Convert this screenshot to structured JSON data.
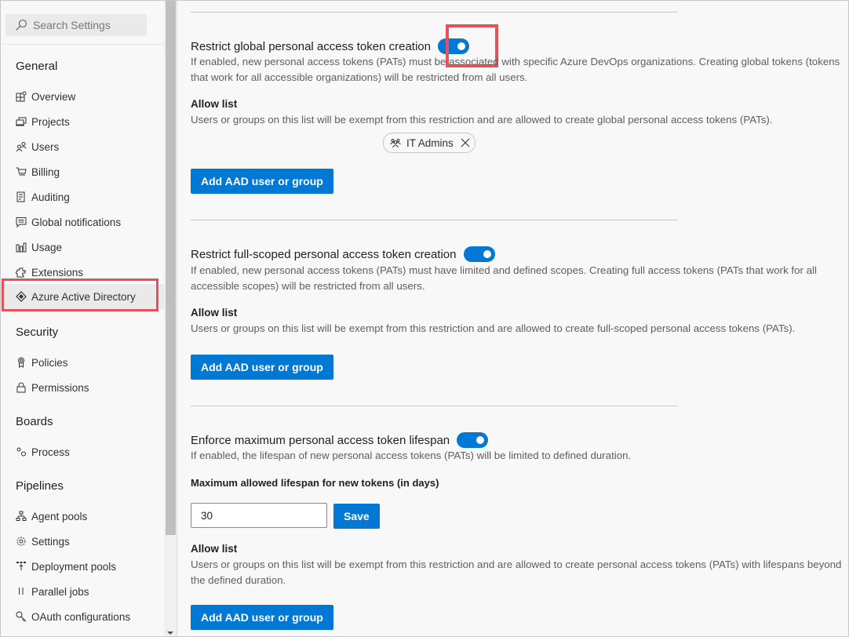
{
  "search": {
    "placeholder": "Search Settings",
    "icon": "search-icon"
  },
  "sidebar": {
    "groups": [
      {
        "title": "General"
      },
      {
        "title": "Security"
      },
      {
        "title": "Boards"
      },
      {
        "title": "Pipelines"
      }
    ],
    "items": [
      {
        "label": "Overview",
        "icon": "overview-icon"
      },
      {
        "label": "Projects",
        "icon": "projects-icon"
      },
      {
        "label": "Users",
        "icon": "users-icon"
      },
      {
        "label": "Billing",
        "icon": "cart-icon"
      },
      {
        "label": "Auditing",
        "icon": "auditing-icon"
      },
      {
        "label": "Global notifications",
        "icon": "notification-icon"
      },
      {
        "label": "Usage",
        "icon": "usage-icon"
      },
      {
        "label": "Extensions",
        "icon": "extensions-icon"
      },
      {
        "label": "Azure Active Directory",
        "icon": "aad-icon",
        "selected": true
      },
      {
        "label": "Policies",
        "icon": "policy-icon"
      },
      {
        "label": "Permissions",
        "icon": "lock-icon"
      },
      {
        "label": "Process",
        "icon": "process-icon"
      },
      {
        "label": "Agent pools",
        "icon": "agent-pools-icon"
      },
      {
        "label": "Settings",
        "icon": "gear-icon"
      },
      {
        "label": "Deployment pools",
        "icon": "deployment-pools-icon"
      },
      {
        "label": "Parallel jobs",
        "icon": "parallel-jobs-icon"
      },
      {
        "label": "OAuth configurations",
        "icon": "key-icon"
      }
    ]
  },
  "sections": [
    {
      "title": "Restrict global personal access token creation",
      "enabled": true,
      "description": "If enabled, new personal access tokens (PATs) must be associated with specific Azure DevOps organizations. Creating global tokens (tokens that work for all accessible organizations) will be restricted from all users.",
      "allow_list_label": "Allow list",
      "allow_list_description": "Users or groups on this list will be exempt from this restriction and are allowed to create global personal access tokens (PATs).",
      "allow_list_entries": [
        {
          "name": "IT Admins",
          "icon": "group-icon"
        }
      ],
      "add_button": "Add AAD user or group"
    },
    {
      "title": "Restrict full-scoped personal access token creation",
      "enabled": true,
      "description": "If enabled, new personal access tokens (PATs) must have limited and defined scopes. Creating full access tokens (PATs that work for all accessible scopes) will be restricted from all users.",
      "allow_list_label": "Allow list",
      "allow_list_description": "Users or groups on this list will be exempt from this restriction and are allowed to create full-scoped personal access tokens (PATs).",
      "add_button": "Add AAD user or group"
    },
    {
      "title": "Enforce maximum personal access token lifespan",
      "enabled": true,
      "description": "If enabled, the lifespan of new personal access tokens (PATs) will be limited to defined duration.",
      "lifespan_label": "Maximum allowed lifespan for new tokens (in days)",
      "lifespan_value": "30",
      "save_button": "Save",
      "allow_list_label": "Allow list",
      "allow_list_description": "Users or groups on this list will be exempt from this restriction and are allowed to create personal access tokens (PATs) with lifespans beyond the defined duration.",
      "add_button": "Add AAD user or group"
    }
  ],
  "colors": {
    "accent": "#0078d4",
    "highlight": "#e8515a",
    "selected_bg": "#eaeaea"
  }
}
